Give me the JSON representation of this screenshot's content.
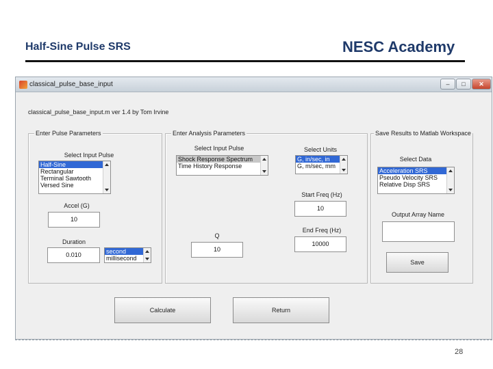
{
  "slide": {
    "title": "Half-Sine Pulse SRS",
    "brand": "NESC Academy",
    "page_number": "28"
  },
  "window": {
    "title": "classical_pulse_base_input",
    "buttons": {
      "minimize": "–",
      "maximize": "□",
      "close": "✕"
    },
    "version_text": "classical_pulse_base_input.m  ver 1.4  by Tom Irvine"
  },
  "pulse_panel": {
    "title": "Enter Pulse Parameters",
    "select_label": "Select Input Pulse",
    "pulse_types": [
      "Half-Sine",
      "Rectangular",
      "Terminal Sawtooth",
      "Versed Sine"
    ],
    "accel_label": "Accel (G)",
    "accel_value": "10",
    "duration_label": "Duration",
    "duration_value": "0.010",
    "duration_units": [
      "second",
      "millisecond"
    ]
  },
  "analysis_panel": {
    "title": "Enter Analysis Parameters",
    "select_label": "Select Input Pulse",
    "pulse_options": [
      "Shock Response Spectrum",
      "Time History Response"
    ],
    "units_label": "Select Units",
    "units_options": [
      "G, in/sec, in",
      "G, m/sec, mm"
    ],
    "start_freq_label": "Start Freq (Hz)",
    "start_freq_value": "10",
    "end_freq_label": "End Freq (Hz)",
    "end_freq_value": "10000",
    "q_label": "Q",
    "q_value": "10"
  },
  "save_panel": {
    "title": "Save Results to Matlab Workspace",
    "select_label": "Select Data",
    "data_options": [
      "Acceleration SRS",
      "Pseudo Velocity SRS",
      "Relative Disp SRS"
    ],
    "output_label": "Output Array Name",
    "output_value": "",
    "save_label": "Save"
  },
  "actions": {
    "calculate_label": "Calculate",
    "return_label": "Return"
  },
  "colors": {
    "title_blue": "#1f3a6a",
    "selection": "#3168d5",
    "dialog_bg": "#efefef"
  }
}
